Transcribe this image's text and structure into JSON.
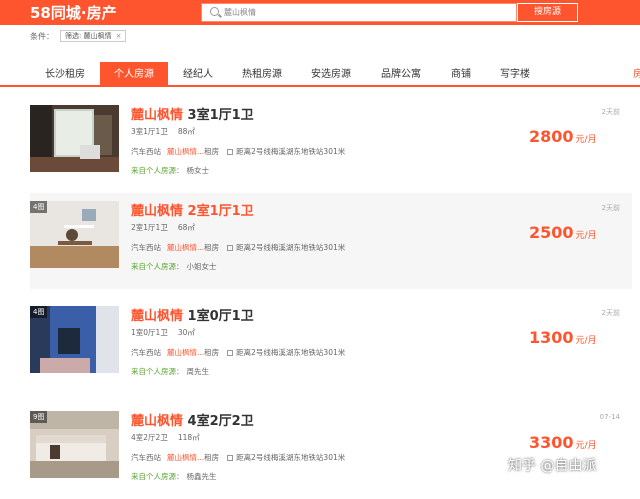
{
  "header": {
    "logo": "58同城·房产",
    "search_value": "麓山枫情",
    "search_button": "搜房源"
  },
  "filter": {
    "label": "条件：",
    "chip": "筛选: 麓山枫情",
    "chip_close": "×"
  },
  "tabs": [
    {
      "label": "长沙租房"
    },
    {
      "label": "个人房源",
      "active": true
    },
    {
      "label": "经纪人"
    },
    {
      "label": "热租房源"
    },
    {
      "label": "安选房源"
    },
    {
      "label": "品牌公寓"
    },
    {
      "label": "商铺"
    },
    {
      "label": "写字楼"
    },
    {
      "label": "房"
    }
  ],
  "listings": [
    {
      "photo_count": "",
      "community": "麓山枫情",
      "layout": "3室1厅1卫",
      "detail_layout": "3室1厅1卫",
      "area": "88㎡",
      "district": "汽车西站",
      "loc_name": "麓山枫情...",
      "rent_type": "租房",
      "subway": "距离2号线梅溪湖东地铁站301米",
      "source": "来自个人房源：",
      "agent": "杨女士",
      "price": "2800",
      "unit": "元/月",
      "time": "2天前"
    },
    {
      "photo_count": "4图",
      "community": "麓山枫情",
      "layout": "2室1厅1卫",
      "detail_layout": "2室1厅1卫",
      "area": "68㎡",
      "district": "汽车西站",
      "loc_name": "麓山枫情...",
      "rent_type": "租房",
      "subway": "距离2号线梅溪湖东地铁站301米",
      "source": "来自个人房源：",
      "agent": "小姐女士",
      "price": "2500",
      "unit": "元/月",
      "time": "2天前"
    },
    {
      "photo_count": "4图",
      "community": "麓山枫情",
      "layout": "1室0厅1卫",
      "detail_layout": "1室0厅1卫",
      "area": "30㎡",
      "district": "汽车西站",
      "loc_name": "麓山枫情...",
      "rent_type": "租房",
      "subway": "距离2号线梅溪湖东地铁站301米",
      "source": "来自个人房源：",
      "agent": "周先生",
      "price": "1300",
      "unit": "元/月",
      "time": "2天前"
    },
    {
      "photo_count": "9图",
      "community": "麓山枫情",
      "layout": "4室2厅2卫",
      "detail_layout": "4室2厅2卫",
      "area": "118㎡",
      "district": "汽车西站",
      "loc_name": "麓山枫情...",
      "rent_type": "租房",
      "subway": "距离2号线梅溪湖东地铁站301米",
      "source": "来自个人房源：",
      "agent": "杨鑫先生",
      "price": "3300",
      "unit": "元/月",
      "time": "07-14"
    }
  ],
  "watermark": "知乎 @自由派",
  "colors": {
    "brand": "#ff552e",
    "source_green": "#5aa52f"
  }
}
